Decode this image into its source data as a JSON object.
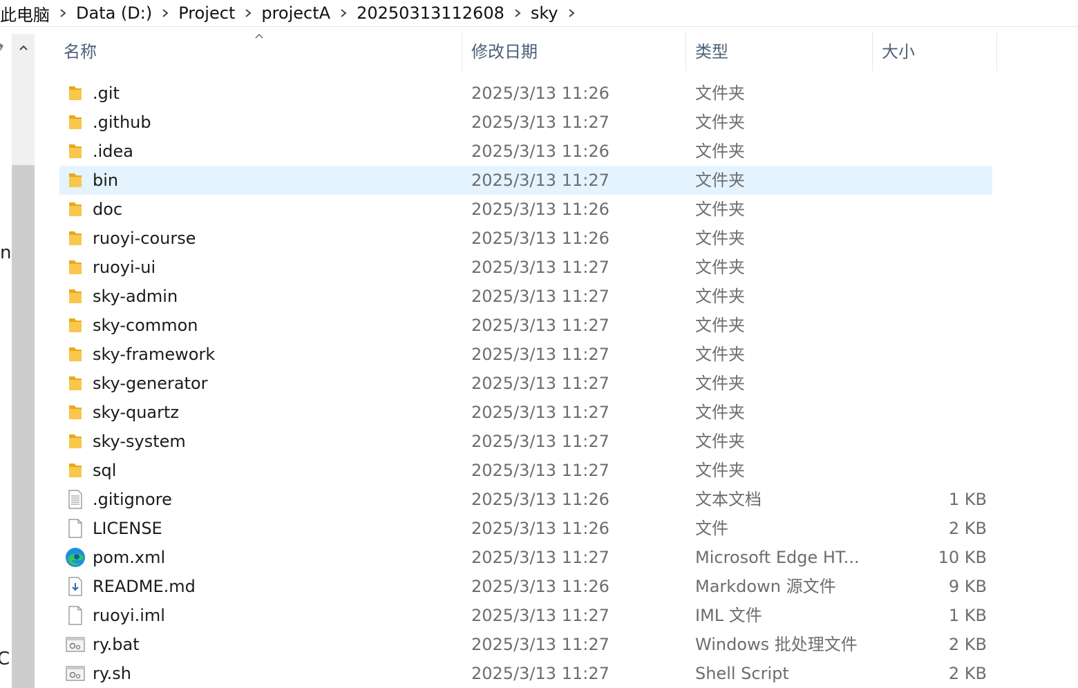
{
  "breadcrumb": {
    "items": [
      "此电脑",
      "Data (D:)",
      "Project",
      "projectA",
      "20250313112608",
      "sky"
    ]
  },
  "left_pane": {
    "glyph_n": "n",
    "glyph_c": "C:"
  },
  "columns": {
    "name": "名称",
    "date": "修改日期",
    "type": "类型",
    "size": "大小"
  },
  "colors": {
    "selected_row": "#e5f3ff",
    "folder": "#f8c74b",
    "header_text": "#4c607a",
    "meta_text": "#6d6d6d"
  },
  "files": [
    {
      "name": ".git",
      "date": "2025/3/13 11:26",
      "type": "文件夹",
      "size": "",
      "icon": "folder-icon"
    },
    {
      "name": ".github",
      "date": "2025/3/13 11:27",
      "type": "文件夹",
      "size": "",
      "icon": "folder-icon"
    },
    {
      "name": ".idea",
      "date": "2025/3/13 11:26",
      "type": "文件夹",
      "size": "",
      "icon": "folder-icon"
    },
    {
      "name": "bin",
      "date": "2025/3/13 11:27",
      "type": "文件夹",
      "size": "",
      "icon": "folder-icon",
      "selected": true
    },
    {
      "name": "doc",
      "date": "2025/3/13 11:26",
      "type": "文件夹",
      "size": "",
      "icon": "folder-icon"
    },
    {
      "name": "ruoyi-course",
      "date": "2025/3/13 11:26",
      "type": "文件夹",
      "size": "",
      "icon": "folder-icon"
    },
    {
      "name": "ruoyi-ui",
      "date": "2025/3/13 11:27",
      "type": "文件夹",
      "size": "",
      "icon": "folder-icon"
    },
    {
      "name": "sky-admin",
      "date": "2025/3/13 11:27",
      "type": "文件夹",
      "size": "",
      "icon": "folder-icon"
    },
    {
      "name": "sky-common",
      "date": "2025/3/13 11:27",
      "type": "文件夹",
      "size": "",
      "icon": "folder-icon"
    },
    {
      "name": "sky-framework",
      "date": "2025/3/13 11:27",
      "type": "文件夹",
      "size": "",
      "icon": "folder-icon"
    },
    {
      "name": "sky-generator",
      "date": "2025/3/13 11:27",
      "type": "文件夹",
      "size": "",
      "icon": "folder-icon"
    },
    {
      "name": "sky-quartz",
      "date": "2025/3/13 11:27",
      "type": "文件夹",
      "size": "",
      "icon": "folder-icon"
    },
    {
      "name": "sky-system",
      "date": "2025/3/13 11:27",
      "type": "文件夹",
      "size": "",
      "icon": "folder-icon"
    },
    {
      "name": "sql",
      "date": "2025/3/13 11:27",
      "type": "文件夹",
      "size": "",
      "icon": "folder-icon"
    },
    {
      "name": ".gitignore",
      "date": "2025/3/13 11:26",
      "type": "文本文档",
      "size": "1 KB",
      "icon": "text-file-icon"
    },
    {
      "name": "LICENSE",
      "date": "2025/3/13 11:26",
      "type": "文件",
      "size": "2 KB",
      "icon": "blank-file-icon"
    },
    {
      "name": "pom.xml",
      "date": "2025/3/13 11:27",
      "type": "Microsoft Edge HT...",
      "size": "10 KB",
      "icon": "edge-icon"
    },
    {
      "name": "README.md",
      "date": "2025/3/13 11:26",
      "type": "Markdown 源文件",
      "size": "9 KB",
      "icon": "markdown-file-icon"
    },
    {
      "name": "ruoyi.iml",
      "date": "2025/3/13 11:27",
      "type": "IML 文件",
      "size": "1 KB",
      "icon": "blank-file-icon"
    },
    {
      "name": "ry.bat",
      "date": "2025/3/13 11:27",
      "type": "Windows 批处理文件",
      "size": "2 KB",
      "icon": "script-file-icon"
    },
    {
      "name": "ry.sh",
      "date": "2025/3/13 11:27",
      "type": "Shell Script",
      "size": "2 KB",
      "icon": "script-file-icon"
    }
  ]
}
